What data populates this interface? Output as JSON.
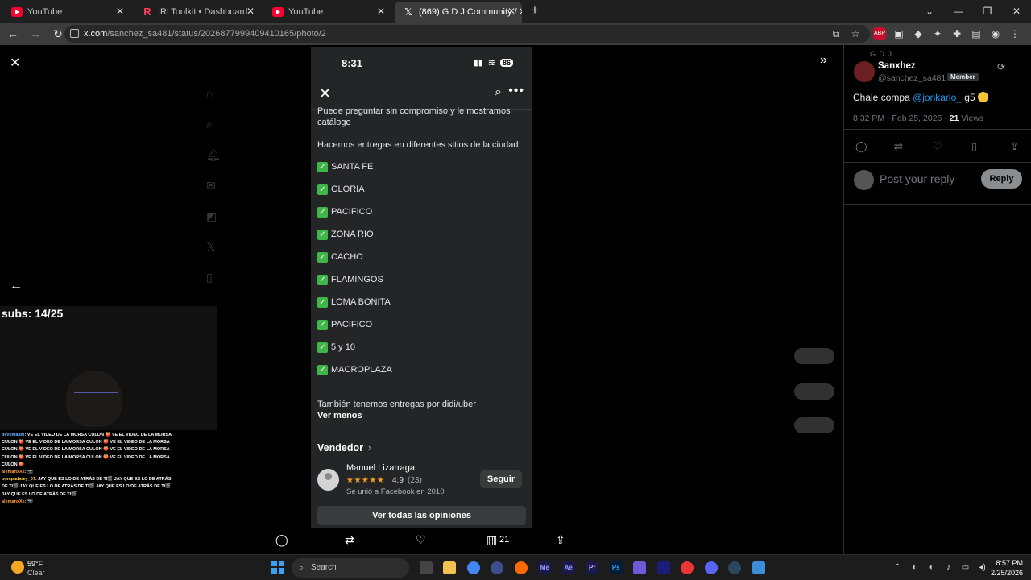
{
  "browser": {
    "tabs": [
      {
        "title": "YouTube",
        "icon": "youtube-icon",
        "active": false
      },
      {
        "title": "IRLToolkit • Dashboard",
        "icon": "irltoolkit-icon",
        "active": false
      },
      {
        "title": "YouTube",
        "icon": "youtube-icon",
        "active": false
      },
      {
        "title": "(869) G D J Community / X",
        "icon": "x-logo-icon",
        "active": true
      }
    ],
    "url_domain": "x.com",
    "url_path": "/sanchez_sa481/status/2026877999409410165/photo/2"
  },
  "photo": {
    "status_time": "8:31",
    "battery": "86",
    "intro_text": "Puede preguntar sin compromiso y le mostramos catálogo",
    "delivery_text": "Hacemos entregas en diferentes sitios de la ciudad:",
    "locations": [
      "SANTA FE",
      "GLORIA",
      "PACIFICO",
      "ZONA RIO",
      "CACHO",
      "FLAMINGOS",
      "LOMA BONITA",
      "PACIFICO",
      "5 y 10",
      "MACROPLAZA"
    ],
    "extra_text": "También tenemos entregas por didi/uber",
    "see_less": "Ver menos",
    "seller_heading": "Vendedor",
    "seller_name": "Manuel Lizarraga",
    "seller_rating": "4.9",
    "seller_review_count": "(23)",
    "seller_rating_value": 4.9,
    "seller_joined": "Se unió a Facebook en 2010",
    "follow_label": "Seguir",
    "all_reviews_label": "Ver todas las opiniones"
  },
  "photo_actions": {
    "views": "21"
  },
  "stream": {
    "subs": "subs: 14/25",
    "chat": [
      {
        "user": "devilmaam",
        "color": "#6ab0ff",
        "text": ": VE EL VIDEO DE LA MORSA CULON 🍑 VE EL VIDEO DE LA MORSA CULON 🍑 VE EL VIDEO DE LA MORSA CULON 🍑 VE EL VIDEO DE LA MORSA CULON 🍑 VE EL VIDEO DE LA MORSA CULON 🍑 VE EL VIDEO DE LA MORSA CULON 🍑 VE EL VIDEO DE LA MORSA CULON 🍑 VE EL VIDEO DE LA MORSA CULON 🍑"
      },
      {
        "user": "alemanxXs",
        "color": "#ff9a3d",
        "text": ": 📷"
      },
      {
        "user": "oompadarey_07",
        "color": "#ffd23d",
        "text": ": JAY QUE ES LO DE ATRÁS DE TI🎬 JAY QUE ES LO DE ATRÁS DE TI🎬 JAY QUE ES LO DE ATRÁS DE TI🎬 JAY QUE ES LO DE ATRÁS DE TI🎬 JAY QUE ES LO DE ATRÁS DE TI🎬"
      },
      {
        "user": "alemanxXs",
        "color": "#ff9a3d",
        "text": ": 📷"
      }
    ]
  },
  "tweet": {
    "community": "G D J",
    "display_name": "Sanxhez",
    "handle": "@sanchez_sa481",
    "badge": "Member",
    "text_before": "Chale compa ",
    "mention": "@jonkarlo_",
    "text_after": " g5",
    "time": "8:32 PM · Feb 25, 2026 · ",
    "views_count": "21",
    "views_label": " Views",
    "reply_placeholder": "Post your reply",
    "reply_button": "Reply"
  },
  "taskbar": {
    "temperature": "59°F",
    "condition": "Clear",
    "search_label": "Search",
    "time": "8:57 PM",
    "date": "2/25/2026"
  }
}
